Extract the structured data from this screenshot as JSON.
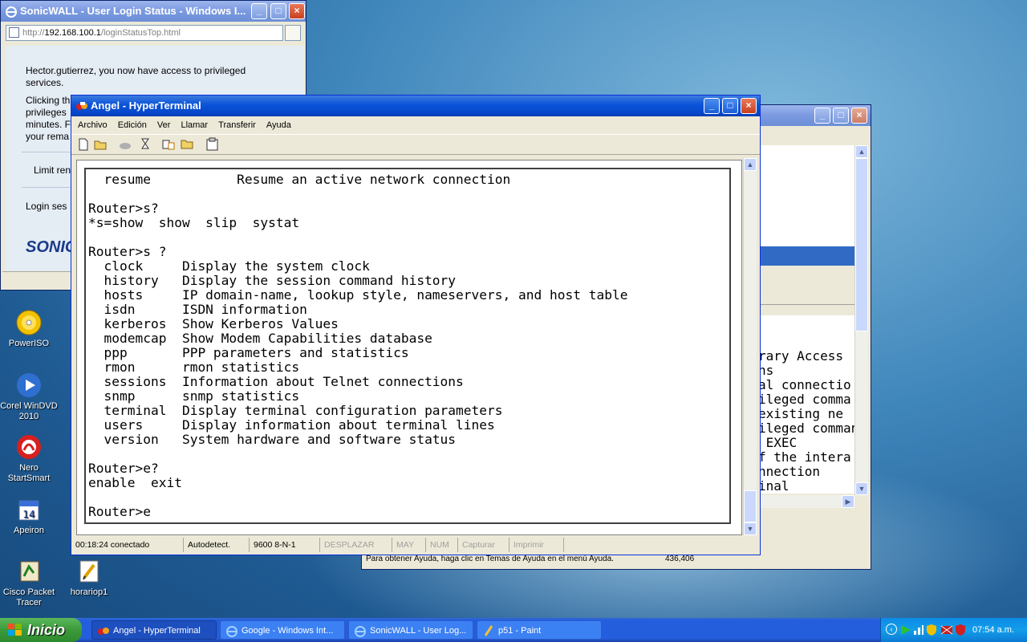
{
  "sonicwall_window": {
    "title": "SonicWALL - User Login Status - Windows I...",
    "url_prefix": "http://",
    "url_host": "192.168.100.1",
    "url_path": "/loginStatusTop.html",
    "msg_line1": "Hector.gutierrez, you now have access to privileged",
    "msg_line2": "services.",
    "msg2_a": "Clicking th",
    "msg2_b": "privileges",
    "msg2_c": "minutes. F",
    "msg2_d": "your rema",
    "limit_label": "Limit ren",
    "login_label": "Login ses",
    "logo_text": "SONICW"
  },
  "back_window": {
    "lines": [
      "rary Access",
      "ns",
      "al connectio",
      "ileged comma",
      "existing ne",
      "ileged comman",
      " EXEC",
      "f the intera",
      "nnection",
      "inal"
    ],
    "status_help": "Para obtener Ayuda, haga clic en Temas de Ayuda en el menú Ayuda.",
    "status_coords": "436,406"
  },
  "hyperterminal": {
    "title": "Angel - HyperTerminal",
    "menu": [
      "Archivo",
      "Edición",
      "Ver",
      "Llamar",
      "Transferir",
      "Ayuda"
    ],
    "terminal_lines": [
      "  resume           Resume an active network connection",
      "",
      "Router>s?",
      "*s=show  show  slip  systat",
      "",
      "Router>s ?",
      "  clock     Display the system clock",
      "  history   Display the session command history",
      "  hosts     IP domain-name, lookup style, nameservers, and host table",
      "  isdn      ISDN information",
      "  kerberos  Show Kerberos Values",
      "  modemcap  Show Modem Capabilities database",
      "  ppp       PPP parameters and statistics",
      "  rmon      rmon statistics",
      "  sessions  Information about Telnet connections",
      "  snmp      snmp statistics",
      "  terminal  Display terminal configuration parameters",
      "  users     Display information about terminal lines",
      "  version   System hardware and software status",
      "",
      "Router>e?",
      "enable  exit",
      "",
      "Router>e"
    ],
    "status": {
      "connected": "00:18:24 conectado",
      "detect": "Autodetect.",
      "params": "9600 8-N-1",
      "scroll": "DESPLAZAR",
      "caps": "MAY",
      "num": "NUM",
      "capture": "Capturar",
      "print": "Imprimir"
    }
  },
  "desktop_icons": [
    {
      "label": "PowerISO",
      "icon": "cd-icon"
    },
    {
      "label": "Corel WinDVD 2010",
      "icon": "dvd-player-icon"
    },
    {
      "label": "Nero StartSmart",
      "icon": "nero-icon"
    },
    {
      "label": "Apeiron",
      "icon": "calendar-icon"
    },
    {
      "label": "Cisco Packet Tracer",
      "icon": "packet-tracer-icon"
    },
    {
      "label": "horariop1",
      "icon": "paint-file-icon"
    }
  ],
  "taskbar": {
    "start_label": "Inicio",
    "tasks": [
      {
        "label": "Angel - HyperTerminal",
        "active": true
      },
      {
        "label": "Google - Windows Int...",
        "active": false
      },
      {
        "label": "SonicWALL - User Log...",
        "active": false
      },
      {
        "label": "p51 - Paint",
        "active": false
      }
    ],
    "clock": "07:54 a.m."
  },
  "colors": {
    "titlebar_blue": "#0a53d8",
    "start_green": "#3a9a3a",
    "taskbar_blue": "#245edc"
  }
}
